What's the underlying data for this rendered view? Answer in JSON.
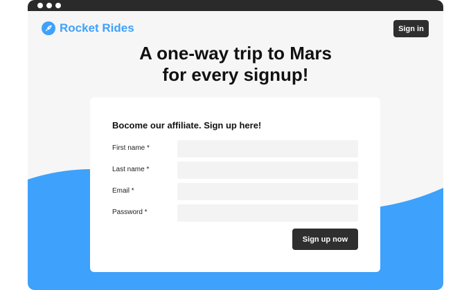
{
  "header": {
    "brand_name": "Rocket Rides",
    "logo_icon": "rocket-icon",
    "sign_in_label": "Sign in"
  },
  "hero": {
    "line1": "A one-way trip to Mars",
    "line2": "for every signup!"
  },
  "form": {
    "title": "Bocome our affiliate. Sign up here!",
    "fields": [
      {
        "label": "First name *",
        "value": ""
      },
      {
        "label": "Last name *",
        "value": ""
      },
      {
        "label": "Email *",
        "value": ""
      },
      {
        "label": "Password *",
        "value": ""
      }
    ],
    "submit_label": "Sign up now"
  },
  "colors": {
    "accent": "#3ea1fb",
    "dark_button": "#2f2f2f",
    "page_background": "#f6f6f6"
  }
}
